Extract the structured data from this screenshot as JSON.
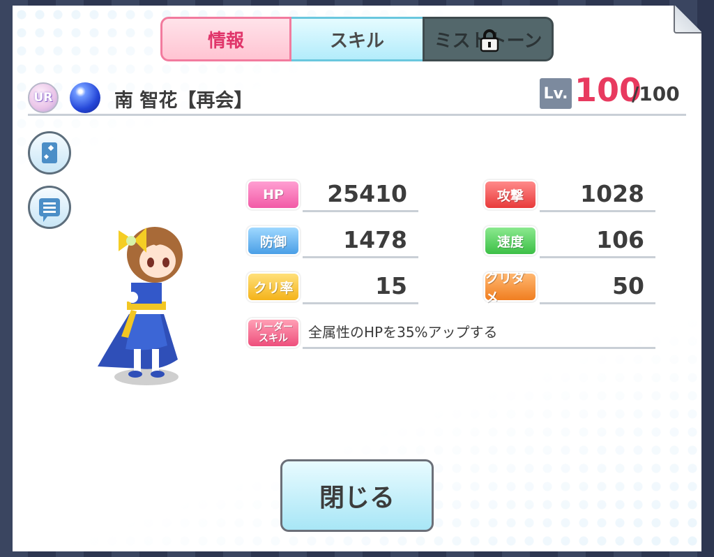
{
  "tabs": {
    "info": "情報",
    "skill": "スキル",
    "mist_stone": "ミストトーン"
  },
  "header": {
    "rarity": "UR",
    "name": "南 智花【再会】",
    "level_label": "Lv.",
    "level_current": "100",
    "level_max": "/100"
  },
  "stats": {
    "hp_label": "HP",
    "hp_value": "25410",
    "attack_label": "攻撃",
    "attack_value": "1028",
    "defense_label": "防御",
    "defense_value": "1478",
    "speed_label": "速度",
    "speed_value": "106",
    "crit_rate_label": "クリ率",
    "crit_rate_value": "15",
    "crit_damage_label": "クリダメ",
    "crit_damage_value": "50",
    "leader_skill_label_1": "リーダー",
    "leader_skill_label_2": "スキル",
    "leader_skill_text": "全属性のHPを35%アップする"
  },
  "close_button": "閉じる",
  "icons": {
    "rarity": "ur-badge-icon",
    "element": "water-orb-icon",
    "card": "card-icon",
    "profile": "chat-bubble-icon",
    "lock": "lock-icon"
  },
  "colors": {
    "accent_pink": "#e83a5f",
    "tab_active": "#ffc4d2",
    "tab_skill": "#b3ecfb",
    "tab_locked": "#53676b"
  }
}
